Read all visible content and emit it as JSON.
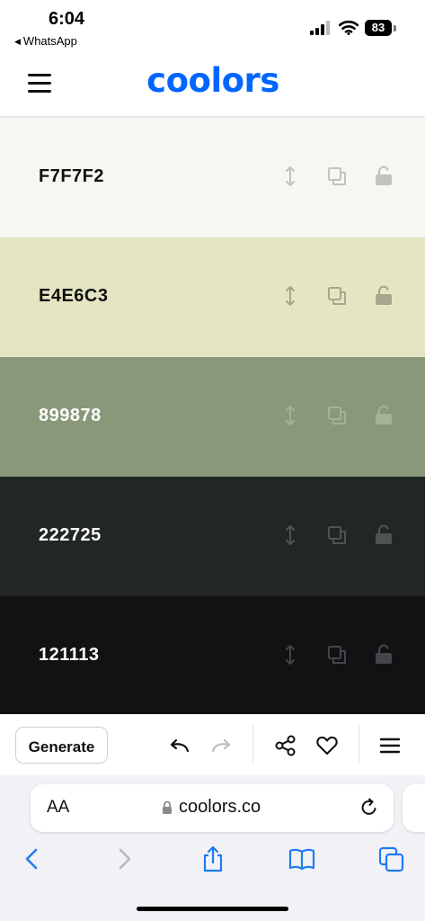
{
  "status_bar": {
    "time": "6:04",
    "back_app": "WhatsApp",
    "battery": "83"
  },
  "header": {
    "logo": "coolors",
    "brand_color": "#0066ff"
  },
  "palette": [
    {
      "hex": "F7F7F2",
      "bg": "#F7F7F2",
      "text_color": "#111111",
      "icon_color": "#c2c2be"
    },
    {
      "hex": "E4E6C3",
      "bg": "#E4E6C3",
      "text_color": "#111111",
      "icon_color": "#a6a88c"
    },
    {
      "hex": "899878",
      "bg": "#899878",
      "text_color": "#ffffff",
      "icon_color": "#a5b197"
    },
    {
      "hex": "222725",
      "bg": "#222725",
      "text_color": "#ffffff",
      "icon_color": "#4f5451"
    },
    {
      "hex": "121113",
      "bg": "#121113",
      "text_color": "#ffffff",
      "icon_color": "#46454a"
    }
  ],
  "toolbar": {
    "generate_label": "Generate"
  },
  "safari": {
    "aa_label": "AA",
    "url": "coolors.co",
    "accent": "#1e7cf2"
  }
}
